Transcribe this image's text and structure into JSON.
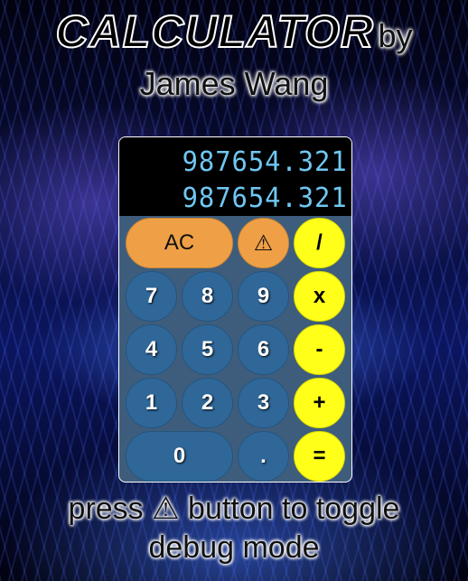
{
  "header": {
    "title_main": "CALCULATOR",
    "title_by": "by",
    "author": "James Wang"
  },
  "display": {
    "previous": "987654.321",
    "current": "987654.321"
  },
  "buttons": {
    "clear": "AC",
    "debug": "⚠",
    "divide": "/",
    "seven": "7",
    "eight": "8",
    "nine": "9",
    "multiply": "x",
    "four": "4",
    "five": "5",
    "six": "6",
    "subtract": "-",
    "one": "1",
    "two": "2",
    "three": "3",
    "add": "+",
    "zero": "0",
    "decimal": ".",
    "equals": "="
  },
  "footer": {
    "line1": "press ⚠ button to toggle",
    "line2": "debug mode"
  },
  "colors": {
    "number_button": "#2f6799",
    "function_button": "#efa046",
    "operator_button": "#ffff1a",
    "display_text": "#6fc7f2",
    "calculator_body": "#3e5d7c"
  }
}
